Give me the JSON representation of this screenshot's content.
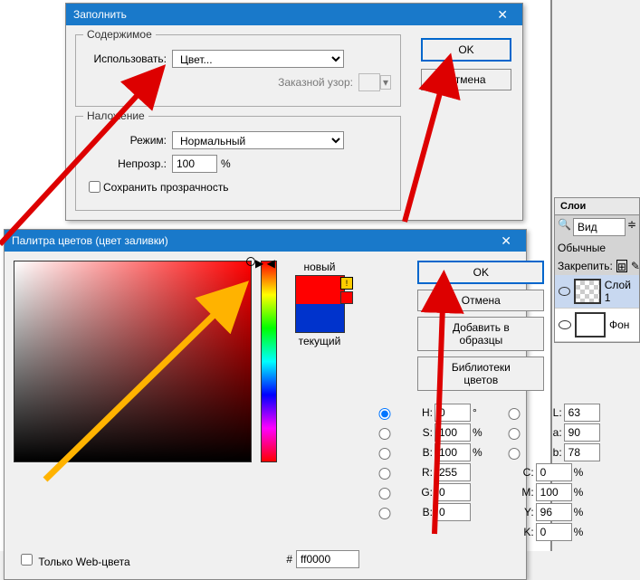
{
  "fill": {
    "title": "Заполнить",
    "content_legend": "Содержимое",
    "use_label": "Использовать:",
    "use_value": "Цвет...",
    "pattern_label": "Заказной узор:",
    "blend_legend": "Наложение",
    "mode_label": "Режим:",
    "mode_value": "Нормальный",
    "opacity_label": "Непрозр.:",
    "opacity_value": "100",
    "percent": "%",
    "preserve": "Сохранить прозрачность",
    "ok": "OK",
    "cancel": "Отмена"
  },
  "picker": {
    "title": "Палитра цветов (цвет заливки)",
    "new": "новый",
    "current": "текущий",
    "ok": "OK",
    "cancel": "Отмена",
    "add": "Добавить в образцы",
    "libraries": "Библиотеки цветов",
    "H": "H:",
    "Hv": "0",
    "Hdeg": "°",
    "S": "S:",
    "Sv": "100",
    "Bv_l": "B:",
    "Bv": "100",
    "R": "R:",
    "Rv": "255",
    "G": "G:",
    "Gv": "0",
    "B": "B:",
    "Bval": "0",
    "L": "L:",
    "Lv": "63",
    "a": "a:",
    "av": "90",
    "b": "b:",
    "bv": "78",
    "C": "C:",
    "Cv": "0",
    "M": "M:",
    "Mv": "100",
    "Y": "Y:",
    "Yv": "96",
    "K": "K:",
    "Kv": "0",
    "pct": "%",
    "hash": "#",
    "hex": "ff0000",
    "webonly": "Только Web-цвета"
  },
  "layers": {
    "tab": "Слои",
    "search": "Вид",
    "mode": "Обычные",
    "lock": "Закрепить:",
    "layer1": "Слой 1",
    "bg": "Фон"
  }
}
